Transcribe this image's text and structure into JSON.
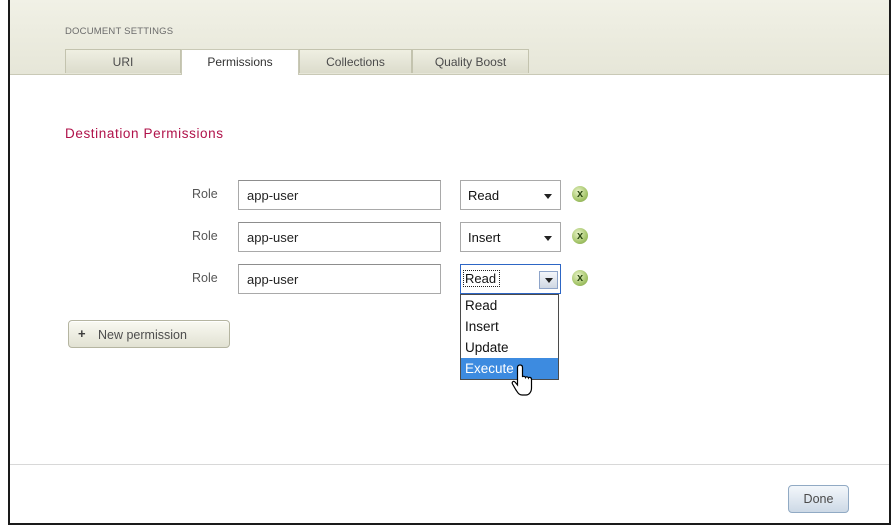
{
  "dialog": {
    "section_label": "DOCUMENT SETTINGS",
    "tabs": [
      {
        "label": "URI",
        "active": false
      },
      {
        "label": "Permissions",
        "active": true
      },
      {
        "label": "Collections",
        "active": false
      },
      {
        "label": "Quality Boost",
        "active": false
      }
    ]
  },
  "permissions": {
    "title": "Destination Permissions",
    "rows": [
      {
        "role_label": "Role",
        "role_value": "app-user",
        "capability": "Read",
        "remove_icon": "remove-x-icon"
      },
      {
        "role_label": "Role",
        "role_value": "app-user",
        "capability": "Insert",
        "remove_icon": "remove-x-icon"
      },
      {
        "role_label": "Role",
        "role_value": "app-user",
        "capability": "Read",
        "remove_icon": "remove-x-icon",
        "dropdown_open": true
      }
    ],
    "dropdown_options": [
      "Read",
      "Insert",
      "Update",
      "Execute"
    ],
    "dropdown_highlighted": "Execute",
    "new_permission_label": "New permission",
    "new_permission_icon": "plus-icon"
  },
  "footer": {
    "done_label": "Done"
  },
  "colors": {
    "accent_title": "#b0124a",
    "highlight": "#3d8be0",
    "header_bg": "#e6e6d8"
  }
}
